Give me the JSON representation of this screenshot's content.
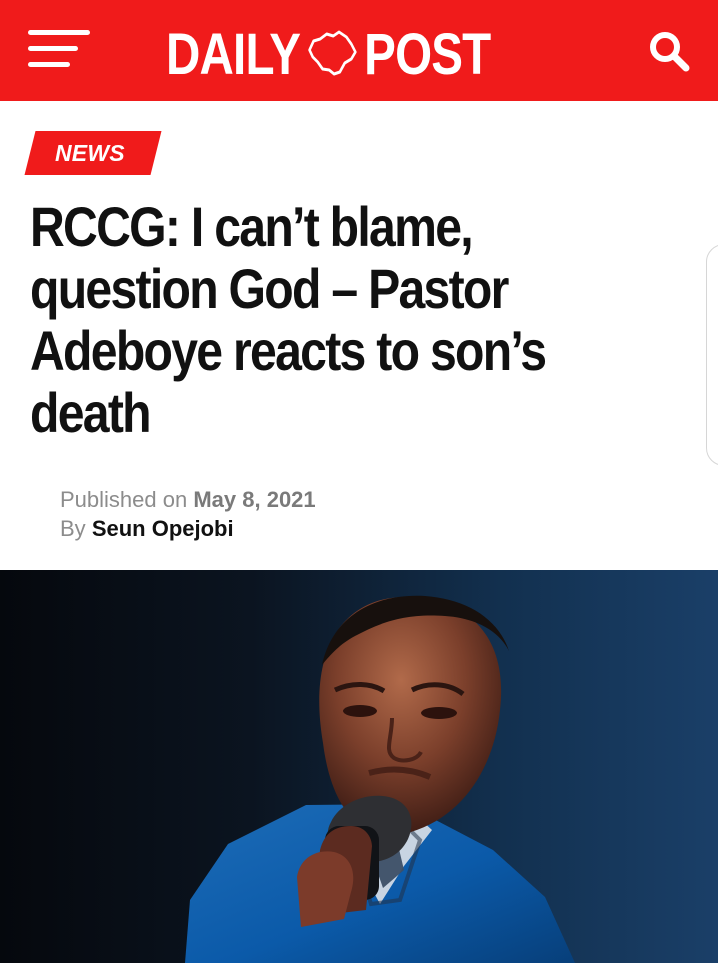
{
  "header": {
    "logo_left": "DAILY",
    "logo_right": "POST",
    "background_color": "#f01b1b",
    "menu_icon": "hamburger-menu-icon",
    "search_icon": "search-icon"
  },
  "article": {
    "category": "NEWS",
    "title": "RCCG: I can’t blame, question God – Pastor Adeboye reacts to son’s death",
    "published_label": "Published on",
    "published_date": "May 8, 2021",
    "by_label": "By",
    "author": "Seun Opejobi"
  },
  "image": {
    "description": "photo of a man in a blue suit speaking into a microphone"
  }
}
